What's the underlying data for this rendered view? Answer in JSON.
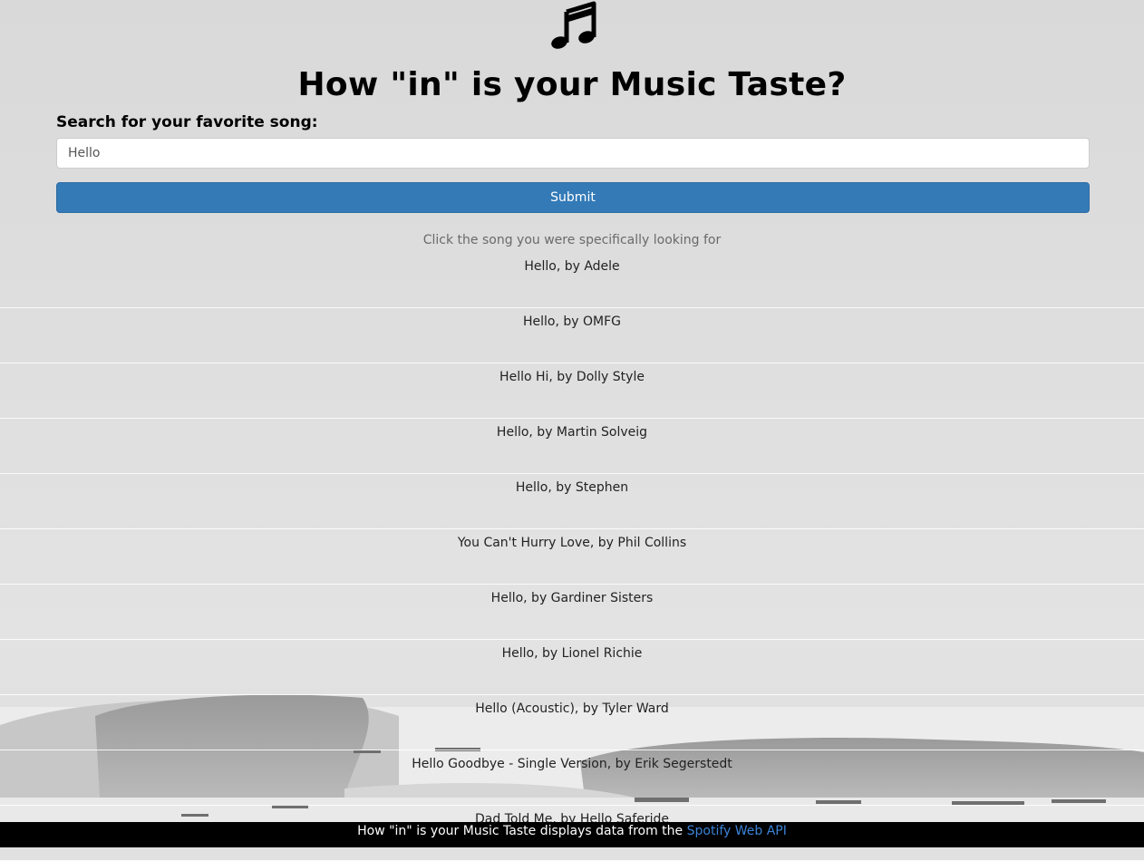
{
  "header": {
    "logo_icon": "music-notes-icon",
    "title": "How \"in\" is your Music Taste?"
  },
  "search": {
    "label": "Search for your favorite song:",
    "value": "Hello",
    "submit_label": "Submit"
  },
  "results": {
    "instructions": "Click the song you were specifically looking for",
    "items": [
      "Hello, by Adele",
      "Hello, by OMFG",
      "Hello Hi, by Dolly Style",
      "Hello, by Martin Solveig",
      "Hello, by Stephen",
      "You Can't Hurry Love, by Phil Collins",
      "Hello, by Gardiner Sisters",
      "Hello, by Lionel Richie",
      "Hello (Acoustic), by Tyler Ward",
      "Hello Goodbye - Single Version, by Erik Segerstedt",
      "Dad Told Me, by Hello Saferide"
    ]
  },
  "footer": {
    "text": "How \"in\" is your Music Taste displays data from the",
    "link_text": "Spotify Web API"
  },
  "colors": {
    "accent": "#337ab7",
    "link": "#3b82d6",
    "footer_bg": "#000000"
  }
}
